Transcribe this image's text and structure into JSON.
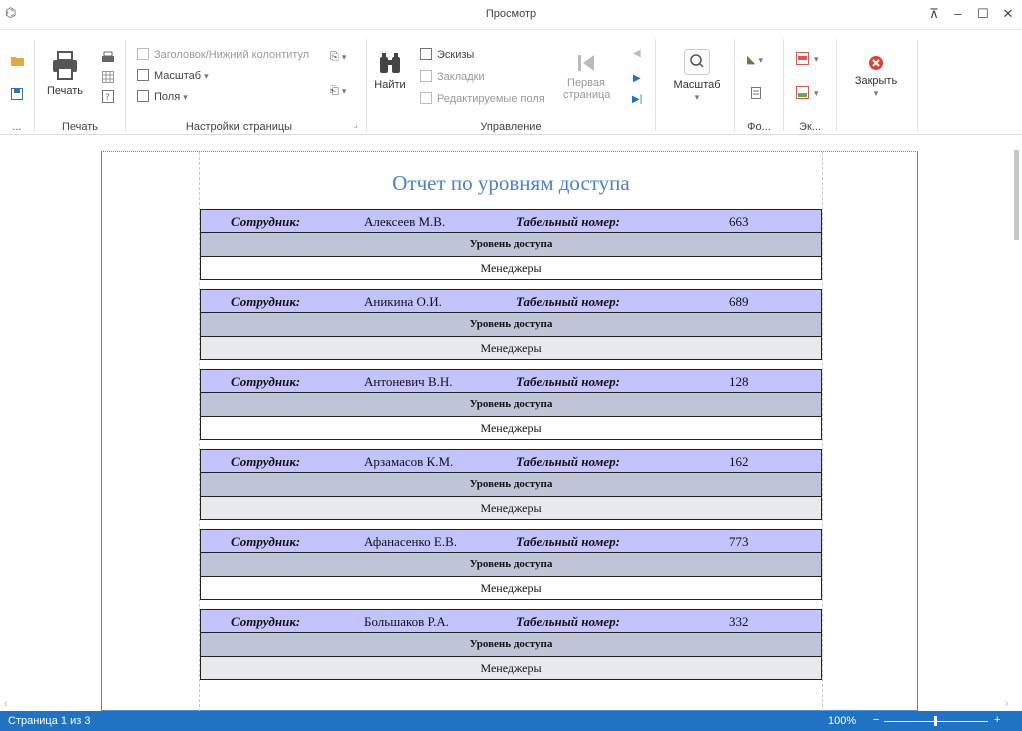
{
  "window": {
    "title": "Просмотр",
    "controls": [
      "⊼",
      "–",
      "☐",
      "✕"
    ]
  },
  "ribbon": {
    "file_group_label": "...",
    "print_group": {
      "print_label": "Печать",
      "group_label": "Печать"
    },
    "page_setup_group": {
      "header_footer": "Заголовок/Нижний колонтитул",
      "scale": "Масштаб",
      "margins": "Поля",
      "group_label": "Настройки страницы"
    },
    "navigation_group": {
      "find_label": "Найти",
      "thumbnails": "Эскизы",
      "bookmarks": "Закладки",
      "editable_fields": "Редактируемые поля",
      "first_page_line1": "Первая",
      "first_page_line2": "страница",
      "group_label": "Управление"
    },
    "zoom_group": {
      "zoom_label": "Масштаб"
    },
    "background_group_label": "Фо...",
    "export_group_label": "Эк...",
    "close_label": "Закрыть"
  },
  "report": {
    "title": "Отчет по уровням доступа",
    "employee_label": "Сотрудник:",
    "tab_label": "Табельный номер:",
    "level_header": "Уровень доступа",
    "records": [
      {
        "name": "Алексеев М.В.",
        "number": "663",
        "level": "Менеджеры"
      },
      {
        "name": "Аникина О.И.",
        "number": "689",
        "level": "Менеджеры"
      },
      {
        "name": "Антоневич В.Н.",
        "number": "128",
        "level": "Менеджеры"
      },
      {
        "name": "Арзамасов К.М.",
        "number": "162",
        "level": "Менеджеры"
      },
      {
        "name": "Афанасенко Е.В.",
        "number": "773",
        "level": "Менеджеры"
      },
      {
        "name": "Большаков Р.А.",
        "number": "332",
        "level": "Менеджеры"
      }
    ]
  },
  "status": {
    "page_info": "Страница 1 из 3",
    "zoom": "100%",
    "minus": "−",
    "plus": "+"
  },
  "colors": {
    "accent": "#1f73c2",
    "title_blue": "#4a7fc9",
    "row_header": "#c3c3ff",
    "level_header": "#c0c4d8"
  }
}
